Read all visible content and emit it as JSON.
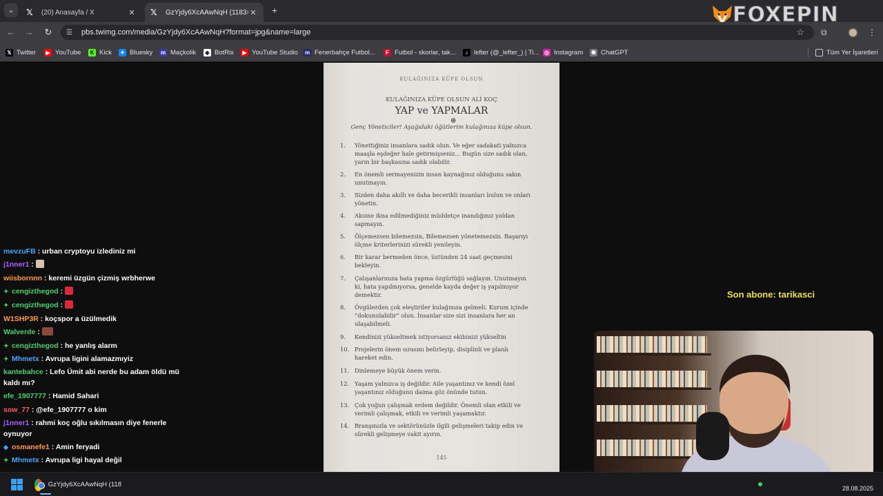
{
  "browser": {
    "tabs": [
      {
        "title": "(20) Anasayfa / X",
        "active": false
      },
      {
        "title": "GzYjdy6XcAAwNqH (1183×2048)",
        "active": true
      }
    ],
    "url": "pbs.twimg.com/media/GzYjdy6XcAAwNqH?format=jpg&name=large",
    "brand_overlay": "FOXEPIN",
    "bookmarks": [
      {
        "label": "Twitter",
        "icon": "x-icon",
        "color": "#000000"
      },
      {
        "label": "YouTube",
        "icon": "youtube-icon",
        "color": "#ff0000"
      },
      {
        "label": "Kick",
        "icon": "kick-icon",
        "color": "#53fc18"
      },
      {
        "label": "Bluesky",
        "icon": "bluesky-icon",
        "color": "#1185fe"
      },
      {
        "label": "Maçkolik",
        "icon": "mackolik-icon",
        "color": "#3a3aa8"
      },
      {
        "label": "BotRix",
        "icon": "botrix-icon",
        "color": "#ffffff"
      },
      {
        "label": "YouTube Studio",
        "icon": "youtube-studio-icon",
        "color": "#ff0000"
      },
      {
        "label": "Fenerbahçe Futbol...",
        "icon": "fenerbahce-icon",
        "color": "#1f2d6b"
      },
      {
        "label": "Futbol - skorlar, tak...",
        "icon": "flashscore-icon",
        "color": "#c8102e"
      },
      {
        "label": "lefter (@_lefter_) | Ti...",
        "icon": "tiktok-icon",
        "color": "#000000"
      },
      {
        "label": "Instagram",
        "icon": "instagram-icon",
        "color": "#d6249f"
      },
      {
        "label": "ChatGPT",
        "icon": "chatgpt-icon",
        "color": "#777777"
      }
    ],
    "all_bookmarks": "Tüm Yer İşaretleri"
  },
  "document": {
    "running_head": "KULAĞINIZA KÜPE OLSUN",
    "eyebrow": "KULAĞINIZA KÜPE OLSUN ALİ KOÇ",
    "heading": "YAP ve YAPMALAR",
    "intro": "Genç Yöneticiler! Aşağıdaki öğütlerim kulağınıza küpe olsun.",
    "items": [
      {
        "n": "1.",
        "text": "Yönettiğiniz insanlara sadık olun. Ve eğer sadakati yalnızca maaşla eşdeğer hale getirmişseniz... Bugün size sadık olan, yarın bir başkasına sadık olabilir."
      },
      {
        "n": "2.",
        "text": "En önemli sermayenizin insan kaynağınız olduğunu sakın unutmayın."
      },
      {
        "n": "3.",
        "text": "Sizden daha akıllı ve daha becerikli insanları bulun ve onları yönetin."
      },
      {
        "n": "4.",
        "text": "Aksine ikna edilmediğiniz müddetçe inandığınız yoldan sapmayın."
      },
      {
        "n": "5.",
        "text": "Ölçemezsen bilemezsin, Bilemezsen yönetemezsin. Başarıyı ölçme kriterlerinizi sürekli yenileyin."
      },
      {
        "n": "6.",
        "text": "Bir karar bermeden önce, üstünden 24 saat geçmesini bekleyin."
      },
      {
        "n": "7.",
        "text": "Çalışanlarınıza hata yapma özgürlüğü sağlayın. Unutmayın ki, hata yapılmıyorsa, genelde kayda değer iş yapılmıyor demektir."
      },
      {
        "n": "8.",
        "text": "Övgülerden çok eleştiriler kulağınıza gelmeli. Kurum içinde “dokunulabilir” olun. İnsanlar size sizi insanlara her an ulaşabilmeli."
      },
      {
        "n": "9.",
        "text": "Kendinizi yükseltmek istiyorsanız ekibinizi yükseltin"
      },
      {
        "n": "10.",
        "text": "Projelerin önem sırasını belirleyip, disiplinli ve planlı hareket edin."
      },
      {
        "n": "11.",
        "text": "Dinlemeye büyük önem verin."
      },
      {
        "n": "12.",
        "text": "Yaşam yalnızca iş değildir. Aile yaşantınız ve kendi özel yaşantınız olduğunu daima göz önünde tutun."
      },
      {
        "n": "13.",
        "text": "Çok yoğun çalışmak erdem değildir. Önemli olan etkili ve verimli çalışmak, etkili ve verimli yaşamaktır."
      },
      {
        "n": "14.",
        "text": "Branşınızla ve sektörünüzle ilgili gelişmeleri takip edin ve sürekli gelişmeye vakit ayırın."
      }
    ],
    "page_number": "145"
  },
  "chat": [
    {
      "user": "mevzuFB",
      "color": "#3ea6ff",
      "text": "urban cryptoyu izlediniz mi",
      "badge": false,
      "emote": null
    },
    {
      "user": "j1nner1",
      "color": "#b05cff",
      "text": "",
      "badge": false,
      "emote": "#d9c2b0"
    },
    {
      "user": "wiisbornnn",
      "color": "#ff9a3c",
      "text": "keremi üzgün çizmiş wrbherwe",
      "badge": false,
      "emote": null
    },
    {
      "user": "cengizthegod",
      "color": "#3fd16b",
      "text": "",
      "badge": true,
      "emote": "#d62a3a"
    },
    {
      "user": "cengizthegod",
      "color": "#3fd16b",
      "text": "",
      "badge": true,
      "emote": "#d62a3a"
    },
    {
      "user": "W1SHP3R",
      "color": "#ff9a3c",
      "text": "koçspor a üzülmedik",
      "badge": false,
      "emote": null
    },
    {
      "user": "Walverde",
      "color": "#3fd16b",
      "text": "",
      "badge": false,
      "emote": "#8a4a3a"
    },
    {
      "user": "cengizthegod",
      "color": "#3fd16b",
      "text": "he yanlış alarm",
      "badge": true,
      "emote": null
    },
    {
      "user": "Mhmetx",
      "color": "#3ea6ff",
      "text": "Avrupa ligini alamazmıyiz",
      "badge": true,
      "emote": null
    },
    {
      "user": "kantebahce",
      "color": "#3fd16b",
      "text": "Lefo Ümit abi nerde bu adam öldü mü kaldı mı?",
      "badge": false,
      "emote": null
    },
    {
      "user": "efe_1907777",
      "color": "#3fd16b",
      "text": "Hamid Sahari",
      "badge": false,
      "emote": null
    },
    {
      "user": "sow_77",
      "color": "#ff5a5a",
      "text": "@efe_1907777 o kim",
      "badge": false,
      "emote": null
    },
    {
      "user": "j1nner1",
      "color": "#b05cff",
      "text": "rahmi koç oğlu sıkılmasın diye fenerle oynuyor",
      "badge": false,
      "emote": null
    },
    {
      "user": "osmanefe1",
      "color": "#ff9a3c",
      "text": "Amin feryadi",
      "badge": true,
      "emote": null
    },
    {
      "user": "Mhmetx",
      "color": "#3ea6ff",
      "text": "Avrupa ligi hayal değil",
      "badge": true,
      "emote": null
    }
  ],
  "overlay": {
    "last_subscriber": "Son abone: tarikasci"
  },
  "taskbar": {
    "app_label": "GzYjdy6XcAAwNqH (118",
    "date": "28.08.2025"
  }
}
